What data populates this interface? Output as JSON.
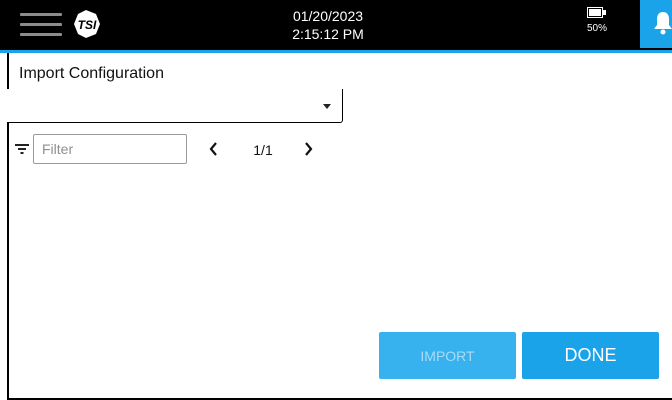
{
  "header": {
    "date": "01/20/2023",
    "time": "2:15:12 PM",
    "battery_percent": "50%",
    "battery_level": 0.5
  },
  "icons": {
    "menu": "hamburger-menu-icon",
    "logo": "tsi-logo",
    "battery": "battery-icon",
    "notifications": "bell-icon",
    "filter": "filter-icon",
    "prev": "chevron-left-icon",
    "next": "chevron-right-icon",
    "dropdown": "caret-down-icon"
  },
  "colors": {
    "accent": "#1aa3e8",
    "disabled_button": "#37b2ee",
    "header_bg": "#000000"
  },
  "page": {
    "title": "Import Configuration",
    "configuration_select": {
      "selected": ""
    },
    "filter": {
      "placeholder": "Filter",
      "value": ""
    },
    "pager": {
      "indicator": "1/1"
    },
    "buttons": {
      "import": "IMPORT",
      "done": "DONE"
    }
  }
}
